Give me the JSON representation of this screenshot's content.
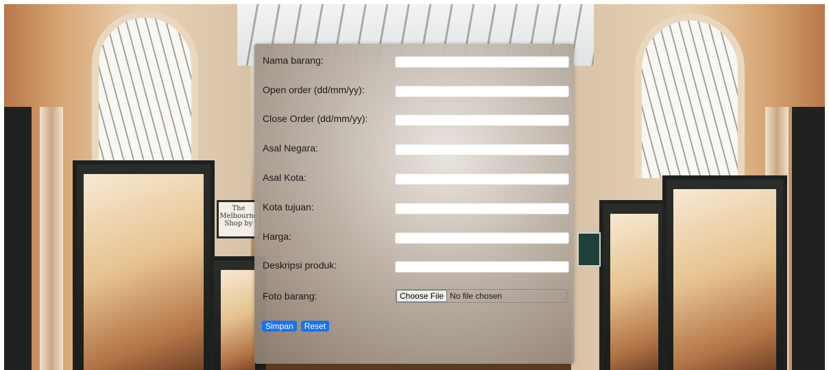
{
  "background": {
    "sign_text": "The Melbourne Shop by"
  },
  "form": {
    "fields": [
      {
        "label": "Nama barang:",
        "value": "",
        "placeholder": ""
      },
      {
        "label": "Open order (dd/mm/yy):",
        "value": "",
        "placeholder": ""
      },
      {
        "label": "Close Order (dd/mm/yy):",
        "value": "",
        "placeholder": ""
      },
      {
        "label": "Asal Negara:",
        "value": "",
        "placeholder": ""
      },
      {
        "label": "Asal Kota:",
        "value": "",
        "placeholder": ""
      },
      {
        "label": "Kota tujuan:",
        "value": "",
        "placeholder": ""
      },
      {
        "label": "Harga:",
        "value": "",
        "placeholder": ""
      },
      {
        "label": "Deskripsi produk:",
        "value": "",
        "placeholder": ""
      }
    ],
    "file": {
      "label": "Foto barang:",
      "button_label": "Choose File",
      "status": "No file chosen"
    },
    "buttons": {
      "submit_label": "Simpan",
      "reset_label": "Reset"
    }
  },
  "colors": {
    "button_blue": "#1a73e8"
  }
}
